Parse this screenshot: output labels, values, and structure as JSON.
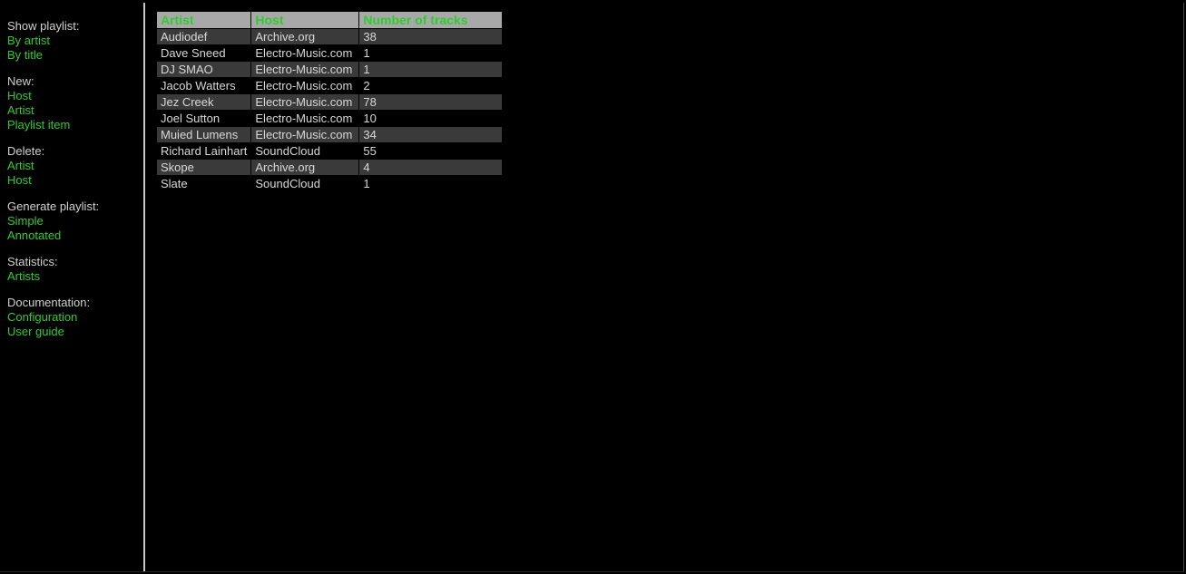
{
  "sidebar": {
    "groups": [
      {
        "heading": "Show playlist:",
        "links": [
          "By artist",
          "By title"
        ]
      },
      {
        "heading": "New:",
        "links": [
          "Host",
          "Artist",
          "Playlist item"
        ]
      },
      {
        "heading": "Delete:",
        "links": [
          "Artist",
          "Host"
        ]
      },
      {
        "heading": "Generate playlist:",
        "links": [
          "Simple",
          "Annotated"
        ]
      },
      {
        "heading": "Statistics:",
        "links": [
          "Artists"
        ]
      },
      {
        "heading": "Documentation:",
        "links": [
          "Configuration",
          "User guide"
        ]
      }
    ]
  },
  "table": {
    "headers": [
      "Artist",
      "Host",
      "Number of tracks"
    ],
    "rows": [
      {
        "artist": "Audiodef",
        "host": "Archive.org",
        "tracks": "38"
      },
      {
        "artist": "Dave Sneed",
        "host": "Electro-Music.com",
        "tracks": "1"
      },
      {
        "artist": "DJ SMAO",
        "host": "Electro-Music.com",
        "tracks": "1"
      },
      {
        "artist": "Jacob Watters",
        "host": "Electro-Music.com",
        "tracks": "2"
      },
      {
        "artist": "Jez Creek",
        "host": "Electro-Music.com",
        "tracks": "78"
      },
      {
        "artist": "Joel Sutton",
        "host": "Electro-Music.com",
        "tracks": "10"
      },
      {
        "artist": "Muied Lumens",
        "host": "Electro-Music.com",
        "tracks": "34"
      },
      {
        "artist": "Richard Lainhart",
        "host": "SoundCloud",
        "tracks": "55"
      },
      {
        "artist": "Skope",
        "host": "Archive.org",
        "tracks": "4"
      },
      {
        "artist": "Slate",
        "host": "SoundCloud",
        "tracks": "1"
      }
    ]
  }
}
